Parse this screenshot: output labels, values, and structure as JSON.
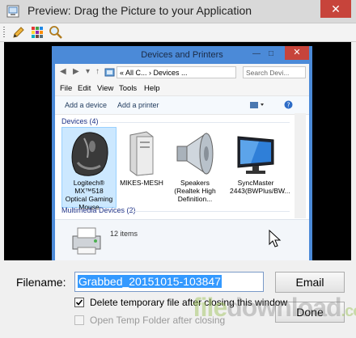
{
  "window": {
    "title": "Preview: Drag the Picture to your Application",
    "close_glyph": "✕"
  },
  "toolbar": {
    "icons": [
      "pencil-icon",
      "color-grid-icon",
      "zoom-icon"
    ]
  },
  "screenshot": {
    "title": "Devices and Printers",
    "controls": {
      "minimize": "—",
      "maximize": "□",
      "close": "✕"
    },
    "address": "« All C... › Devices ...",
    "search_placeholder": "Search Devi...",
    "menu": [
      "File",
      "Edit",
      "View",
      "Tools",
      "Help"
    ],
    "commands": [
      "Add a device",
      "Add a printer"
    ],
    "groups": {
      "devices": "Devices (4)",
      "multimedia": "Multimedia Devices (2)"
    },
    "devices": [
      {
        "name": "Logitech® MX™518 Optical Gaming Mouse",
        "icon": "mouse-icon"
      },
      {
        "name": "MIKES-MESH",
        "icon": "computer-tower-icon"
      },
      {
        "name": "Speakers (Realtek High Definition...",
        "icon": "speaker-icon"
      },
      {
        "name": "SyncMaster 2443(BWPlus/BW...",
        "icon": "monitor-icon"
      }
    ],
    "details_count": "12 items"
  },
  "form": {
    "filename_label": "Filename:",
    "filename_value": "Grabbed_20151015-103847",
    "email_button": "Email",
    "done_button": "Done",
    "delete_temp_label": "Delete temporary file after closing this window",
    "delete_temp_checked": true,
    "open_temp_label": "Open Temp Folder after closing",
    "open_temp_checked": false,
    "open_temp_disabled": true
  },
  "watermark": {
    "prefix": "file",
    "suffix": "download",
    "tld": ".com"
  }
}
